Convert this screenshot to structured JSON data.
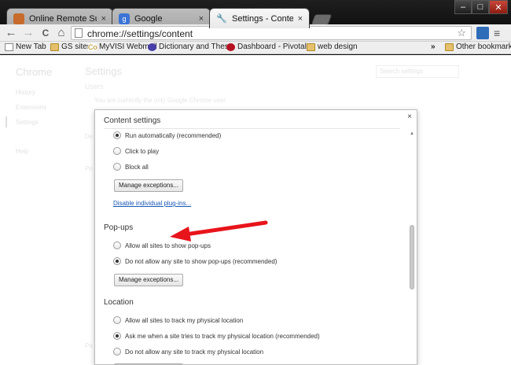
{
  "tabs": [
    {
      "title": "Online Remote Support -",
      "close": "×"
    },
    {
      "title": "Google",
      "close": "×"
    },
    {
      "title": "Settings - Content settings",
      "close": "×"
    }
  ],
  "window_controls": {
    "minimize": "–",
    "maximize": "□",
    "close": "✕"
  },
  "toolbar": {
    "back": "←",
    "forward": "→",
    "reload": "C",
    "home": "⌂",
    "url": "chrome://settings/content",
    "star": "☆",
    "wrench": "≡"
  },
  "bookmarks": [
    {
      "label": "New Tab",
      "icon": "page"
    },
    {
      "label": "GS sites",
      "icon": "folder"
    },
    {
      "label": "MyVISI Webmail",
      "icon": "page"
    },
    {
      "label": "Dictionary and Thes...",
      "icon": "round"
    },
    {
      "label": "Dashboard - Pivotal ...",
      "icon": "round"
    },
    {
      "label": "web design",
      "icon": "folder"
    }
  ],
  "bookmarks_more": "»",
  "other_bookmarks": "Other bookmarks",
  "sidebar": {
    "brand": "Chrome",
    "items": [
      "History",
      "Extensions",
      "Settings",
      "Help"
    ]
  },
  "settings_page": {
    "title": "Settings",
    "users_heading": "Users",
    "users_text": "You are currently the only Google Chrome user.",
    "search_placeholder": "Search settings",
    "partial_de": "De",
    "partial_pri": "Pri",
    "partial_pa": "Pa"
  },
  "dialog": {
    "title": "Content settings",
    "close": "×",
    "plugins": {
      "options": [
        "Run automatically (recommended)",
        "Click to play",
        "Block all"
      ],
      "selected": 0,
      "manage_button": "Manage exceptions...",
      "disable_link": "Disable individual plug-ins..."
    },
    "popups": {
      "heading": "Pop-ups",
      "options": [
        "Allow all sites to show pop-ups",
        "Do not allow any site to show pop-ups (recommended)"
      ],
      "selected": 1,
      "manage_button": "Manage exceptions..."
    },
    "location": {
      "heading": "Location",
      "options": [
        "Allow all sites to track my physical location",
        "Ask me when a site tries to track my physical location (recommended)",
        "Do not allow any site to track my physical location"
      ],
      "selected": 1
    }
  },
  "annotation_arrow_color": "#e8141b",
  "accent_link_color": "#1a58b6"
}
